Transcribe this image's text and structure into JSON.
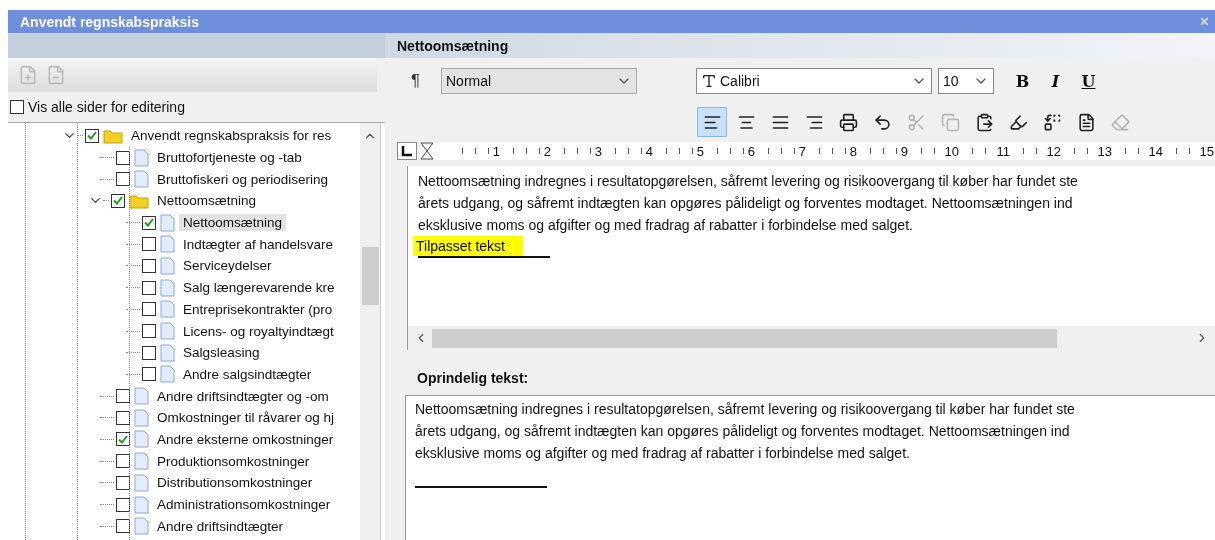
{
  "window": {
    "title": "Anvendt regnskabspraksis",
    "close": "×"
  },
  "sidebar": {
    "toolbar": [
      {
        "kind": "add",
        "disabled": true
      },
      {
        "kind": "remove",
        "disabled": true
      }
    ],
    "show_all": {
      "label": "Vis alle sider for editering",
      "checked": false
    },
    "tree": [
      {
        "label": "Anvendt regnskabspraksis for res",
        "kind": "folder",
        "checked": true,
        "selected": false,
        "expanded": true,
        "children": [
          {
            "label": "Bruttofortjeneste og -tab",
            "kind": "page",
            "checked": false,
            "selected": false
          },
          {
            "label": "Bruttofiskeri og periodisering",
            "kind": "page",
            "checked": false,
            "selected": false
          },
          {
            "label": "Nettoomsætning",
            "kind": "folder",
            "checked": true,
            "selected": false,
            "expanded": true,
            "children": [
              {
                "label": "Nettoomsætning",
                "kind": "page",
                "checked": true,
                "selected": true
              },
              {
                "label": "Indtægter af handelsvare",
                "kind": "page",
                "checked": false,
                "selected": false
              },
              {
                "label": "Serviceydelser",
                "kind": "page",
                "checked": false,
                "selected": false
              },
              {
                "label": "Salg længerevarende kre",
                "kind": "page",
                "checked": false,
                "selected": false
              },
              {
                "label": "Entreprisekontrakter (pro",
                "kind": "page",
                "checked": false,
                "selected": false
              },
              {
                "label": "Licens- og royaltyindtægt",
                "kind": "page",
                "checked": false,
                "selected": false
              },
              {
                "label": "Salgsleasing",
                "kind": "page",
                "checked": false,
                "selected": false
              },
              {
                "label": "Andre salgsindtægter",
                "kind": "page",
                "checked": false,
                "selected": false
              }
            ]
          },
          {
            "label": "Andre driftsindtægter og -om",
            "kind": "page",
            "checked": false,
            "selected": false
          },
          {
            "label": "Omkostninger til råvarer og hj",
            "kind": "page",
            "checked": false,
            "selected": false
          },
          {
            "label": "Andre eksterne omkostninger",
            "kind": "page",
            "checked": true,
            "selected": false
          },
          {
            "label": "Produktionsomkostninger",
            "kind": "page",
            "checked": false,
            "selected": false
          },
          {
            "label": "Distributionsomkostninger",
            "kind": "page",
            "checked": false,
            "selected": false
          },
          {
            "label": "Administrationsomkostninger",
            "kind": "page",
            "checked": false,
            "selected": false
          },
          {
            "label": "Andre driftsindtægter",
            "kind": "page",
            "checked": false,
            "selected": false
          }
        ]
      }
    ]
  },
  "editor": {
    "title": "Nettoomsætning",
    "paragraph_mark": "¶",
    "style": "Normal",
    "font": "Calibri",
    "size": "10",
    "format_buttons": [
      {
        "label": "B",
        "kind": "bold"
      },
      {
        "label": "I",
        "kind": "italic"
      },
      {
        "label": "U",
        "kind": "underline"
      }
    ],
    "tools": [
      {
        "kind": "align-left",
        "selected": true,
        "disabled": false
      },
      {
        "kind": "align-center",
        "selected": false,
        "disabled": false
      },
      {
        "kind": "align-justify",
        "selected": false,
        "disabled": false
      },
      {
        "kind": "align-right",
        "selected": false,
        "disabled": false
      },
      {
        "kind": "print",
        "selected": false,
        "disabled": false
      },
      {
        "kind": "undo",
        "selected": false,
        "disabled": false
      },
      {
        "kind": "cut",
        "selected": false,
        "disabled": true
      },
      {
        "kind": "copy",
        "selected": false,
        "disabled": true
      },
      {
        "kind": "paste",
        "selected": false,
        "disabled": false
      },
      {
        "kind": "highlight",
        "selected": false,
        "disabled": false
      },
      {
        "kind": "replace",
        "selected": false,
        "disabled": false
      },
      {
        "kind": "document",
        "selected": false,
        "disabled": false
      },
      {
        "kind": "erase",
        "selected": false,
        "disabled": true
      }
    ],
    "ruler": [
      "1",
      "2",
      "3",
      "4",
      "5",
      "6",
      "7",
      "8",
      "9",
      "10",
      "11",
      "12",
      "13",
      "14",
      "15"
    ],
    "custom_text": {
      "lines": [
        "Nettoomsætning indregnes i resultatopgørelsen, såfremt levering og risikoovergang til køber har fundet ste",
        "årets udgang, og såfremt indtægten kan opgøres pålideligt og forventes modtaget. Nettoomsætningen ind",
        "eksklusive moms og afgifter og med fradrag af rabatter i forbindelse med salget."
      ],
      "highlight": "Tilpasset tekst"
    },
    "original_label": "Oprindelig tekst:",
    "original_text": {
      "lines": [
        "Nettoomsætning indregnes i resultatopgørelsen, såfremt levering og risikoovergang til køber har fundet ste",
        "årets udgang, og såfremt indtægten kan opgøres pålideligt og forventes modtaget. Nettoomsætningen ind",
        "eksklusive moms og afgifter og med fradrag af rabatter i forbindelse med salget."
      ]
    }
  }
}
